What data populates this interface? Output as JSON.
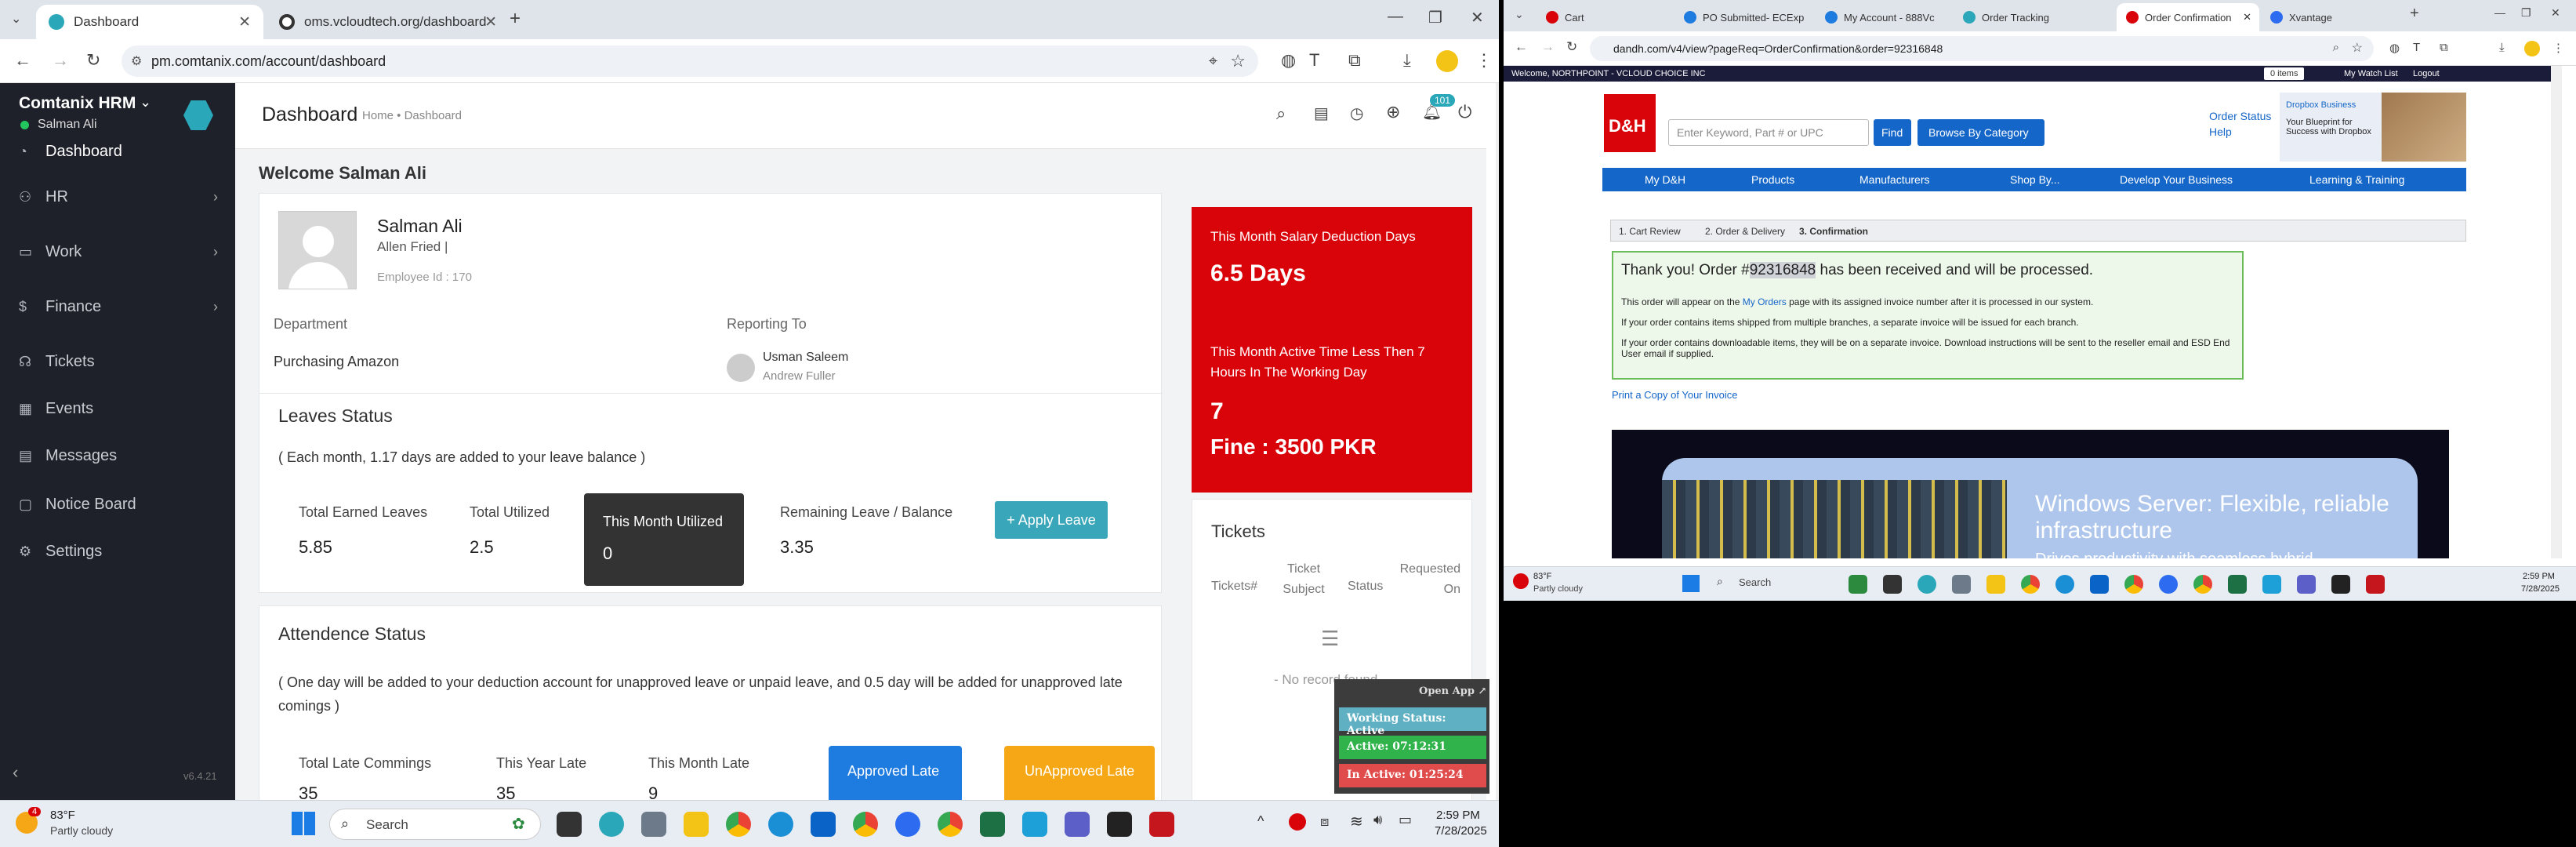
{
  "left_browser": {
    "tabs": [
      {
        "title": "Dashboard",
        "active": true
      },
      {
        "title": "oms.vcloudtech.org/dashboard",
        "active": false
      }
    ],
    "address": "pm.comtanix.com/account/dashboard"
  },
  "hrm": {
    "brand": "Comtanix HRM",
    "user_name": "Salman Ali",
    "version": "v6.4.21",
    "nav": [
      {
        "label": "Dashboard",
        "icon": "dashboard-icon",
        "active": true,
        "chevron": false
      },
      {
        "label": "HR",
        "icon": "users-icon",
        "active": false,
        "chevron": true
      },
      {
        "label": "Work",
        "icon": "briefcase-icon",
        "active": false,
        "chevron": true
      },
      {
        "label": "Finance",
        "icon": "dollar-icon",
        "active": false,
        "chevron": true
      },
      {
        "label": "Tickets",
        "icon": "headset-icon",
        "active": false,
        "chevron": false
      },
      {
        "label": "Events",
        "icon": "calendar-icon",
        "active": false,
        "chevron": false
      },
      {
        "label": "Messages",
        "icon": "message-icon",
        "active": false,
        "chevron": false
      },
      {
        "label": "Notice Board",
        "icon": "clipboard-icon",
        "active": false,
        "chevron": false
      },
      {
        "label": "Settings",
        "icon": "gear-icon",
        "active": false,
        "chevron": false
      }
    ],
    "page_title": "Dashboard",
    "breadcrumb": "Home • Dashboard",
    "notif_count": "101",
    "welcome": "Welcome Salman Ali",
    "profile": {
      "name": "Salman Ali",
      "subtitle": "Allen Fried |",
      "employee_id": "Employee Id : 170",
      "department_label": "Department",
      "department": "Purchasing Amazon",
      "reporting_label": "Reporting To",
      "reporting_name": "Usman Saleem",
      "reporting_sub": "Andrew Fuller"
    },
    "leaves": {
      "title": "Leaves Status",
      "note": "( Each month, 1.17 days are added to your leave balance )",
      "earned_label": "Total Earned Leaves",
      "earned": "5.85",
      "utilized_label": "Total Utilized",
      "utilized": "2.5",
      "month_label": "This Month Utilized",
      "month": "0",
      "remaining_label": "Remaining Leave / Balance",
      "remaining": "3.35",
      "apply_button": "+ Apply Leave"
    },
    "attendance": {
      "title": "Attendence Status",
      "note": "( One day will be added to your deduction account for unapproved leave or unpaid leave, and 0.5 day will be added for unapproved late comings )",
      "late_label": "Total Late Commings",
      "late": "35",
      "year_label": "This Year Late",
      "year": "35",
      "month_label": "This Month Late",
      "month": "9",
      "approved_label": "Approved Late",
      "unapproved_label": "UnApproved Late"
    },
    "salary": {
      "title": "This Month Salary Deduction Days",
      "days": "6.5 Days",
      "active_title": "This Month Active Time Less Then 7 Hours In The Working Day",
      "active_value": "7",
      "fine": "Fine : 3500 PKR"
    },
    "tickets": {
      "title": "Tickets",
      "columns": [
        "Tickets#",
        "Ticket Subject",
        "Status",
        "Requested On"
      ],
      "empty": "- No record found -"
    }
  },
  "status_widget": {
    "open_app": "Open App ↗",
    "working": "Working Status: Active",
    "active": "Active: 07:12:31",
    "inactive": "In Active: 01:25:24"
  },
  "left_taskbar": {
    "temp": "83°F",
    "weather": "Partly cloudy",
    "search": "Search",
    "time": "2:59 PM",
    "date": "7/28/2025",
    "badge": "4"
  },
  "right_browser": {
    "tabs": [
      {
        "title": "Cart"
      },
      {
        "title": "PO Submitted- ECExp"
      },
      {
        "title": "My Account - 888Vc"
      },
      {
        "title": "Order Tracking"
      },
      {
        "title": "Order Confirmation"
      },
      {
        "title": "Xvantage"
      }
    ],
    "address": "dandh.com/v4/view?pageReq=OrderConfirmation&order=92316848"
  },
  "dh": {
    "welcome": "Welcome, NORTHPOINT - VCLOUD CHOICE INC",
    "cart": "0 items",
    "watchlist": "My Watch List",
    "logout": "Logout",
    "logo": "D&H",
    "search_placeholder": "Enter Keyword, Part # or UPC",
    "find": "Find",
    "browse": "Browse By Category",
    "order_status": "Order Status",
    "help": "Help",
    "ad_text": "Your Blueprint for Success with Dropbox",
    "ad_brand": "Dropbox Business",
    "nav": [
      "My D&H",
      "Products",
      "Manufacturers",
      "Shop By...",
      "Develop Your Business",
      "Learning & Training"
    ],
    "steps": [
      "1. Cart Review",
      "2. Order & Delivery",
      "3. Confirmation"
    ],
    "thanks_pre": "Thank you! Order #",
    "order_number": "92316848",
    "thanks_post": " has been received and will be processed.",
    "line1_pre": "This order will appear on the ",
    "line1_link": "My Orders",
    "line1_post": " page with its assigned invoice number after it is processed in our system.",
    "line2": "If your order contains items shipped from multiple branches, a separate invoice will be issued for each branch.",
    "line3": "If your order contains downloadable items, they will be on a separate invoice. Download instructions will be sent to the reseller email and ESD End User email if supplied.",
    "print": "Print a Copy of Your Invoice",
    "banner_title": "Windows Server: Flexible, reliable infrastructure",
    "banner_sub": "Drives productivity with seamless hybrid"
  },
  "right_taskbar": {
    "temp": "83°F",
    "weather": "Partly cloudy",
    "search": "Search",
    "time": "2:59 PM",
    "date": "7/28/2025"
  }
}
